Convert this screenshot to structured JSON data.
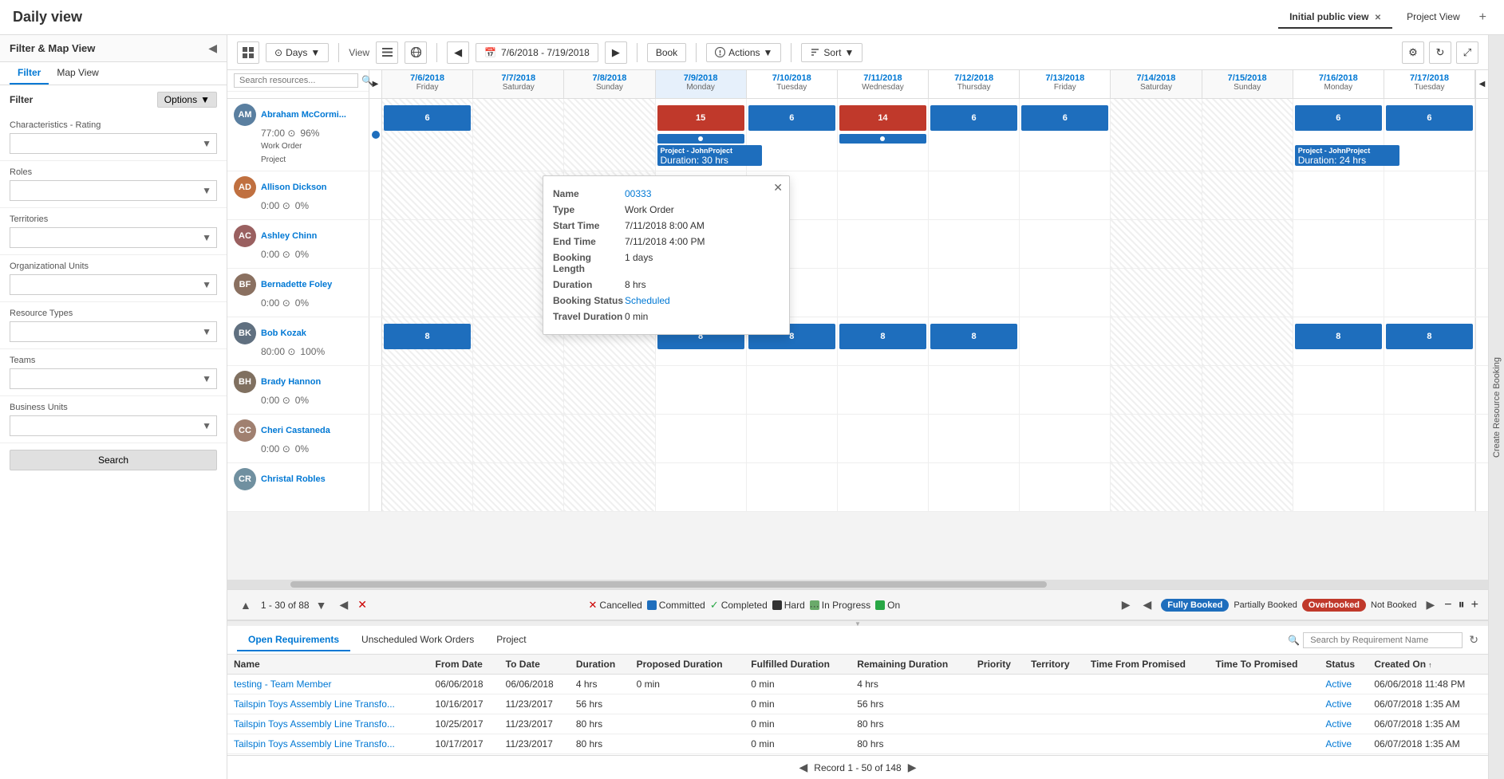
{
  "app": {
    "title": "Daily view",
    "tabs": [
      {
        "label": "Initial public view",
        "active": true
      },
      {
        "label": "Project View",
        "active": false
      }
    ],
    "add_tab_icon": "+"
  },
  "toolbar": {
    "days_label": "Days",
    "view_label": "View",
    "date_range": "7/6/2018 - 7/19/2018",
    "book_label": "Book",
    "actions_label": "Actions",
    "sort_label": "Sort"
  },
  "left_panel": {
    "title": "Filter & Map View",
    "tabs": [
      "Filter",
      "Map View"
    ],
    "filter_label": "Filter",
    "options_label": "Options",
    "sections": [
      {
        "label": "Characteristics - Rating"
      },
      {
        "label": "Roles"
      },
      {
        "label": "Territories"
      },
      {
        "label": "Organizational Units"
      },
      {
        "label": "Resource Types"
      },
      {
        "label": "Teams"
      },
      {
        "label": "Business Units"
      }
    ],
    "search_button": "Search"
  },
  "grid": {
    "search_placeholder": "Search resources...",
    "dates": [
      {
        "date": "7/6/2018",
        "day": "Friday",
        "weekend": true
      },
      {
        "date": "7/7/2018",
        "day": "Saturday",
        "weekend": true
      },
      {
        "date": "7/8/2018",
        "day": "Sunday",
        "weekend": true
      },
      {
        "date": "7/9/2018",
        "day": "Monday",
        "weekend": false,
        "today": true
      },
      {
        "date": "7/10/2018",
        "day": "Tuesday",
        "weekend": false
      },
      {
        "date": "7/11/2018",
        "day": "Wednesday",
        "weekend": false
      },
      {
        "date": "7/12/2018",
        "day": "Thursday",
        "weekend": false
      },
      {
        "date": "7/13/2018",
        "day": "Friday",
        "weekend": false
      },
      {
        "date": "7/14/2018",
        "day": "Saturday",
        "weekend": true
      },
      {
        "date": "7/15/2018",
        "day": "Sunday",
        "weekend": true
      },
      {
        "date": "7/16/2018",
        "day": "Monday",
        "weekend": false
      },
      {
        "date": "7/17/2018",
        "day": "Tuesday",
        "weekend": false
      }
    ],
    "resources": [
      {
        "name": "Abraham McCormi...",
        "hours": "77:00",
        "utilization": "96%",
        "has_avatar": true,
        "avatar_color": "#5a7fa0",
        "avatar_initials": "AM",
        "sub_rows": [
          "Work Order",
          "Project"
        ],
        "bookings": [
          {
            "col": 3,
            "value": "15",
            "type": "red"
          },
          {
            "col": 5,
            "value": "14",
            "type": "red"
          },
          {
            "col": 0,
            "value": "6"
          },
          {
            "col": 4,
            "value": "6"
          },
          {
            "col": 6,
            "value": "6"
          },
          {
            "col": 7,
            "value": "6"
          },
          {
            "col": 10,
            "value": "6"
          },
          {
            "col": 11,
            "value": "6"
          }
        ]
      },
      {
        "name": "Allison Dickson",
        "hours": "0:00",
        "utilization": "0%",
        "avatar_color": "#c07040",
        "avatar_initials": "AD"
      },
      {
        "name": "Ashley Chinn",
        "hours": "0:00",
        "utilization": "0%",
        "avatar_color": "#9a6060",
        "avatar_initials": "AC"
      },
      {
        "name": "Bernadette Foley",
        "hours": "0:00",
        "utilization": "0%",
        "avatar_color": "#8a7060",
        "avatar_initials": "BF"
      },
      {
        "name": "Bob Kozak",
        "hours": "80:00",
        "utilization": "100%",
        "avatar_color": "#607080",
        "avatar_initials": "BK",
        "bookings": [
          {
            "col": 0,
            "value": "8"
          },
          {
            "col": 3,
            "value": "8"
          },
          {
            "col": 4,
            "value": "8"
          },
          {
            "col": 6,
            "value": "8"
          },
          {
            "col": 10,
            "value": "8"
          },
          {
            "col": 11,
            "value": "8"
          }
        ]
      },
      {
        "name": "Brady Hannon",
        "hours": "0:00",
        "utilization": "0%",
        "avatar_color": "#807060",
        "avatar_initials": "BH"
      },
      {
        "name": "Cheri Castaneda",
        "hours": "0:00",
        "utilization": "0%",
        "avatar_color": "#a08070",
        "avatar_initials": "CC"
      },
      {
        "name": "Christal Robles",
        "hours": "",
        "utilization": "",
        "avatar_color": "#7090a0",
        "avatar_initials": "CR"
      }
    ]
  },
  "pagination": {
    "info": "1 - 30 of 88",
    "prev_icon": "▲",
    "next_icon": "▼"
  },
  "legend": {
    "cancelled": "Cancelled",
    "committed": "Committed",
    "completed": "Completed",
    "hard": "Hard",
    "in_progress": "In Progress",
    "on": "On",
    "fully_booked": "Fully Booked",
    "partially_booked": "Partially Booked",
    "overbooked": "Overbooked",
    "not_booked": "Not Booked"
  },
  "popup": {
    "name_label": "Name",
    "name_value": "00333",
    "type_label": "Type",
    "type_value": "Work Order",
    "start_time_label": "Start Time",
    "start_time_value": "7/11/2018 8:00 AM",
    "end_time_label": "End Time",
    "end_time_value": "7/11/2018 4:00 PM",
    "booking_length_label": "Booking Length",
    "booking_length_value": "1 days",
    "duration_label": "Duration",
    "duration_value": "8 hrs",
    "booking_status_label": "Booking Status",
    "booking_status_value": "Scheduled",
    "travel_duration_label": "Travel Duration",
    "travel_duration_value": "0 min"
  },
  "bottom_tabs": [
    {
      "label": "Open Requirements",
      "active": true
    },
    {
      "label": "Unscheduled Work Orders",
      "active": false
    },
    {
      "label": "Project",
      "active": false
    }
  ],
  "bottom_search": {
    "placeholder": "Search by Requirement Name"
  },
  "table": {
    "columns": [
      "Name",
      "From Date",
      "To Date",
      "Duration",
      "Proposed Duration",
      "Fulfilled Duration",
      "Remaining Duration",
      "Priority",
      "Territory",
      "Time From Promised",
      "Time To Promised",
      "Status",
      "Created On"
    ],
    "rows": [
      {
        "name": "testing - Team Member",
        "from_date": "06/06/2018",
        "to_date": "06/06/2018",
        "duration": "4 hrs",
        "proposed_duration": "0 min",
        "fulfilled_duration": "0 min",
        "remaining_duration": "4 hrs",
        "priority": "",
        "territory": "",
        "time_from": "",
        "time_to": "",
        "status": "Active",
        "created_on": "06/06/2018 11:48 PM"
      },
      {
        "name": "Tailspin Toys Assembly Line Transfo...",
        "from_date": "10/16/2017",
        "to_date": "11/23/2017",
        "duration": "56 hrs",
        "proposed_duration": "",
        "fulfilled_duration": "0 min",
        "remaining_duration": "56 hrs",
        "priority": "",
        "territory": "",
        "time_from": "",
        "time_to": "",
        "status": "Active",
        "created_on": "06/07/2018 1:35 AM"
      },
      {
        "name": "Tailspin Toys Assembly Line Transfo...",
        "from_date": "10/25/2017",
        "to_date": "11/23/2017",
        "duration": "80 hrs",
        "proposed_duration": "",
        "fulfilled_duration": "0 min",
        "remaining_duration": "80 hrs",
        "priority": "",
        "territory": "",
        "time_from": "",
        "time_to": "",
        "status": "Active",
        "created_on": "06/07/2018 1:35 AM"
      },
      {
        "name": "Tailspin Toys Assembly Line Transfo...",
        "from_date": "10/17/2017",
        "to_date": "11/23/2017",
        "duration": "80 hrs",
        "proposed_duration": "",
        "fulfilled_duration": "0 min",
        "remaining_duration": "80 hrs",
        "priority": "",
        "territory": "",
        "time_from": "",
        "time_to": "",
        "status": "Active",
        "created_on": "06/07/2018 1:35 AM"
      }
    ],
    "footer": {
      "record_label": "Record 1 - 50 of 148"
    }
  },
  "right_edge": {
    "label": "Create Resource Booking"
  }
}
